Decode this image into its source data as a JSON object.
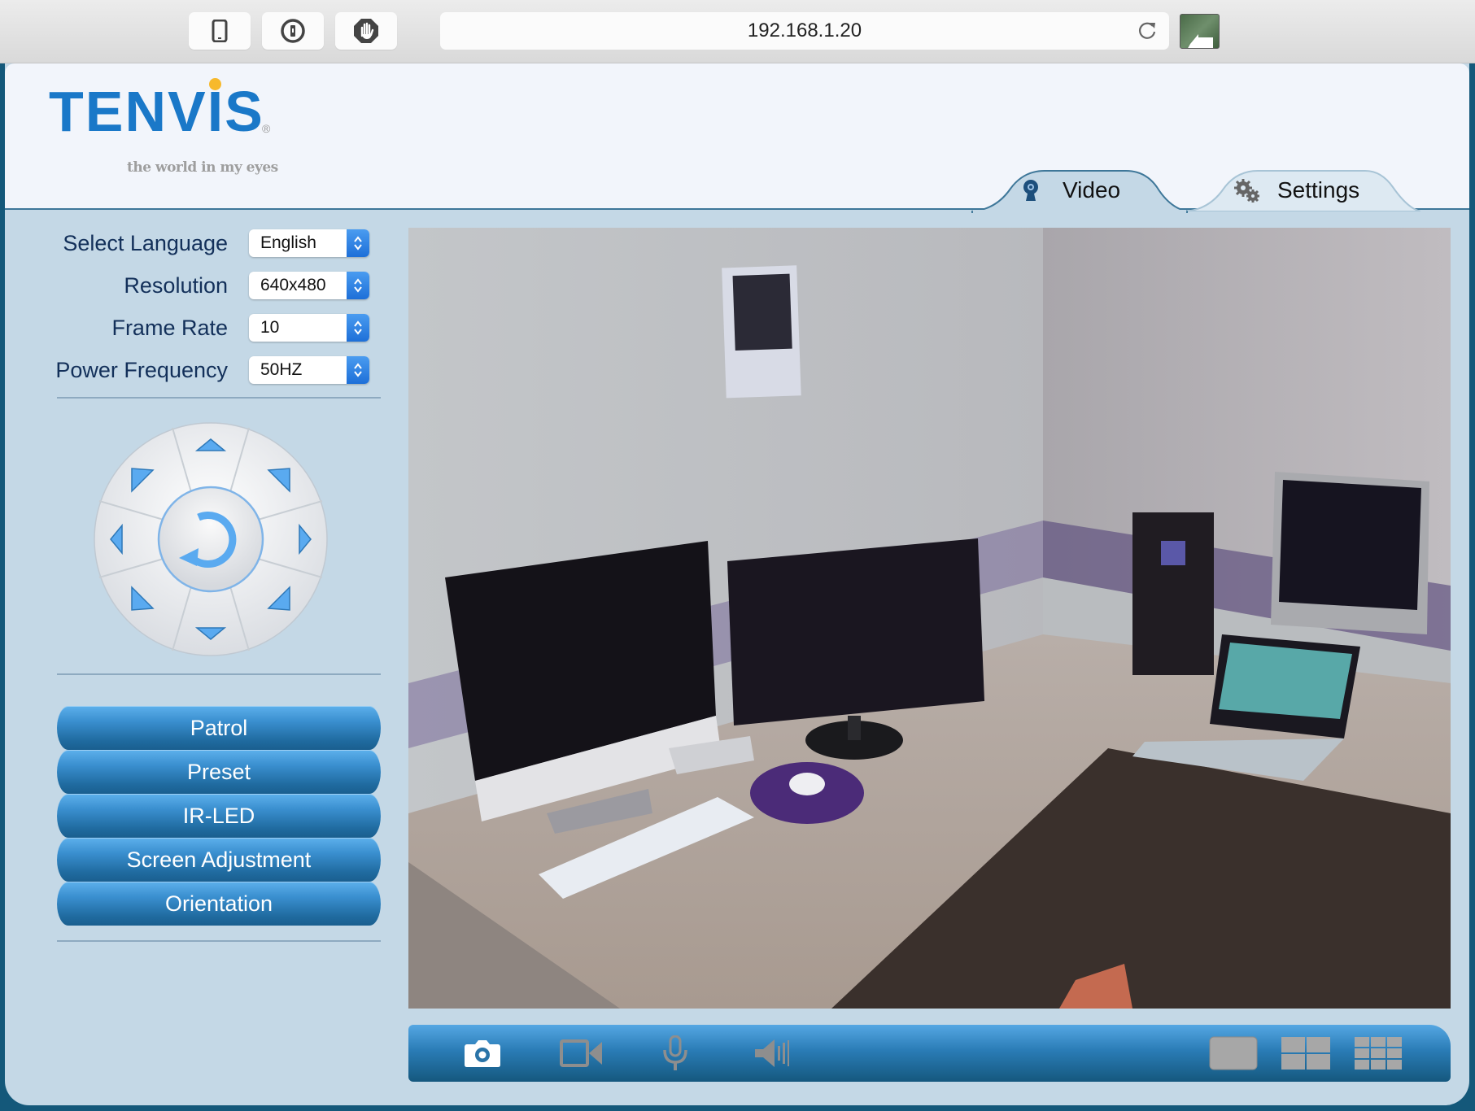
{
  "browser": {
    "url": "192.168.1.20",
    "extension_buttons": [
      {
        "name": "mobile-device-icon"
      },
      {
        "name": "password-manager-icon"
      },
      {
        "name": "adblock-hand-icon"
      }
    ],
    "reload_icon": "reload-icon",
    "extension_right_icon": "reader-arrow-icon"
  },
  "header": {
    "logo_text": "TENVIS",
    "logo_registered": "®",
    "logo_tagline": "the world in my eyes",
    "tabs": [
      {
        "label": "Video",
        "icon": "webcam-icon",
        "active": true
      },
      {
        "label": "Settings",
        "icon": "gears-icon",
        "active": false
      }
    ]
  },
  "settings_form": {
    "fields": [
      {
        "label": "Select Language",
        "value": "English"
      },
      {
        "label": "Resolution",
        "value": "640x480"
      },
      {
        "label": "Frame Rate",
        "value": "10"
      },
      {
        "label": "Power Frequency",
        "value": "50HZ"
      }
    ]
  },
  "ptz_control": {
    "directions": [
      "up",
      "up-right",
      "right",
      "down-right",
      "down",
      "down-left",
      "left",
      "up-left"
    ],
    "center": "reset-rotate-icon"
  },
  "menu_buttons": [
    {
      "label": "Patrol"
    },
    {
      "label": "Preset"
    },
    {
      "label": "IR-LED"
    },
    {
      "label": "Screen Adjustment"
    },
    {
      "label": "Orientation"
    }
  ],
  "video_toolbar": {
    "left_icons": [
      {
        "name": "snapshot-camera-icon",
        "enabled": true
      },
      {
        "name": "record-video-icon",
        "enabled": false
      },
      {
        "name": "microphone-icon",
        "enabled": false
      },
      {
        "name": "speaker-icon",
        "enabled": false
      }
    ],
    "layout_icons": [
      {
        "name": "layout-1-view-icon"
      },
      {
        "name": "layout-4-view-icon"
      },
      {
        "name": "layout-9-view-icon"
      }
    ]
  },
  "colors": {
    "brand_blue": "#1a78c8",
    "panel_bg": "#c4d8e6",
    "frame_dark": "#14587a",
    "button_blue": "#3a8fcf"
  }
}
